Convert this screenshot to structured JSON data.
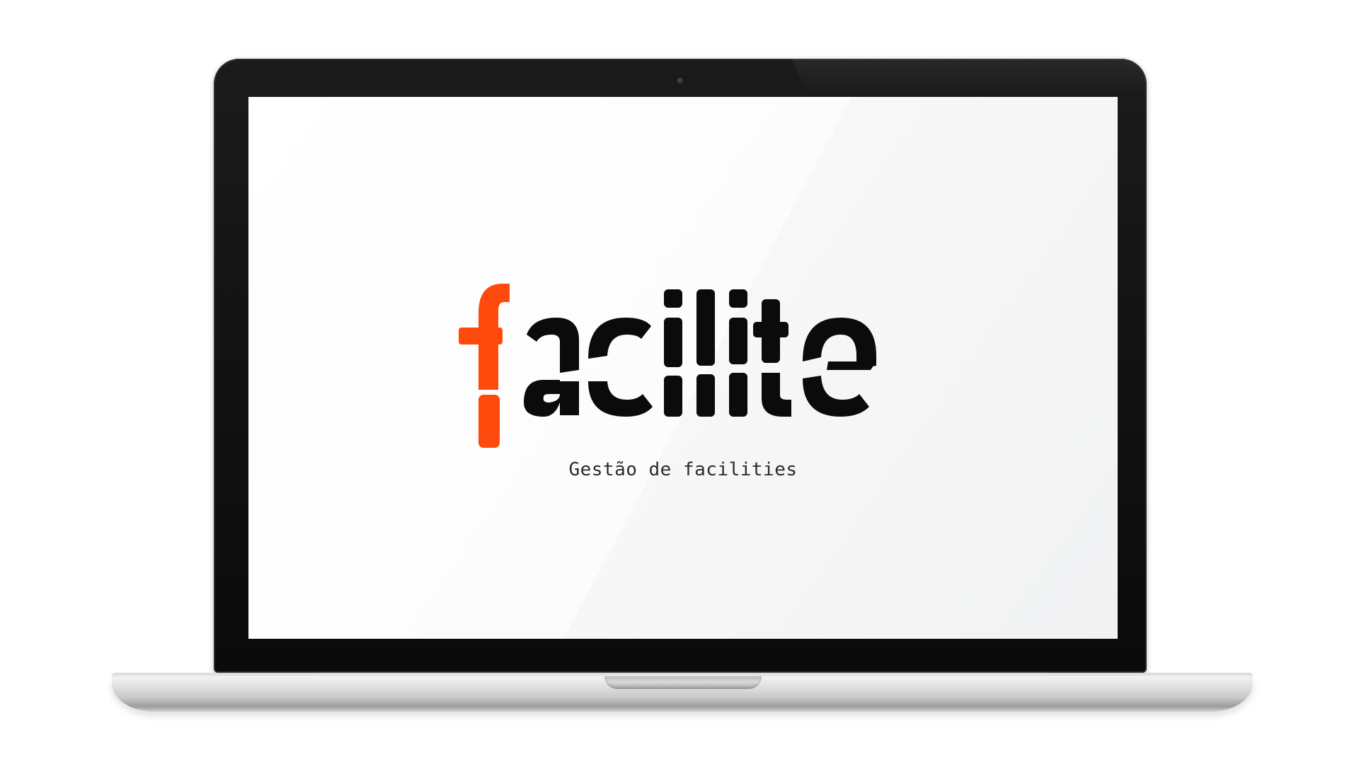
{
  "screen": {
    "logo": {
      "text": "facilite",
      "accent_letter": "f",
      "accent_color": "#ff4a0d",
      "text_color": "#0b0b0b"
    },
    "tagline": "Gestão de facilities"
  },
  "device": {
    "type": "laptop",
    "bezel_color": "#0d0d0d",
    "base_color": "#d0d0d0"
  }
}
